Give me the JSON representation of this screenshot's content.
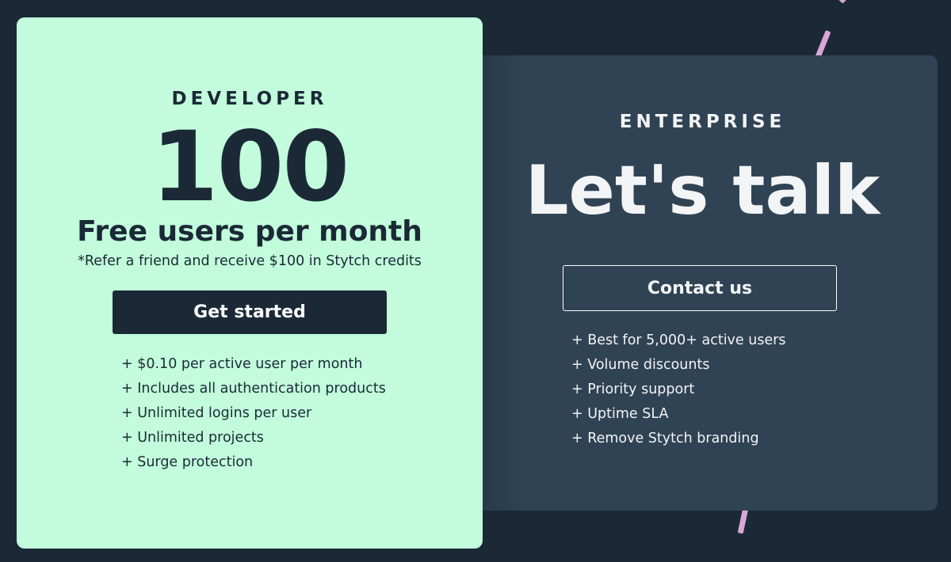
{
  "colors": {
    "page_bg": "#1b2937",
    "developer_card_bg": "#c2fcdc",
    "developer_text": "#1b2937",
    "developer_button_bg": "#1b2937",
    "developer_button_text": "#ffffff",
    "enterprise_card_bg": "#2f4354",
    "enterprise_text": "#f3f4f6",
    "enterprise_button_border": "#ffffff",
    "accent_stripe": "#d9a6d6"
  },
  "developer": {
    "label": "DEVELOPER",
    "price": "100",
    "subtitle": "Free users per month",
    "note": "*Refer a friend and receive $100 in Stytch credits",
    "button": "Get started",
    "features": [
      "+ $0.10 per active user per month",
      "+ Includes all authentication products",
      "+ Unlimited logins per user",
      "+ Unlimited projects",
      "+ Surge protection"
    ]
  },
  "enterprise": {
    "label": "ENTERPRISE",
    "title": "Let's talk",
    "button": "Contact us",
    "features": [
      "+ Best for 5,000+ active users",
      "+ Volume discounts",
      "+ Priority support",
      "+ Uptime SLA",
      "+ Remove Stytch branding"
    ]
  }
}
